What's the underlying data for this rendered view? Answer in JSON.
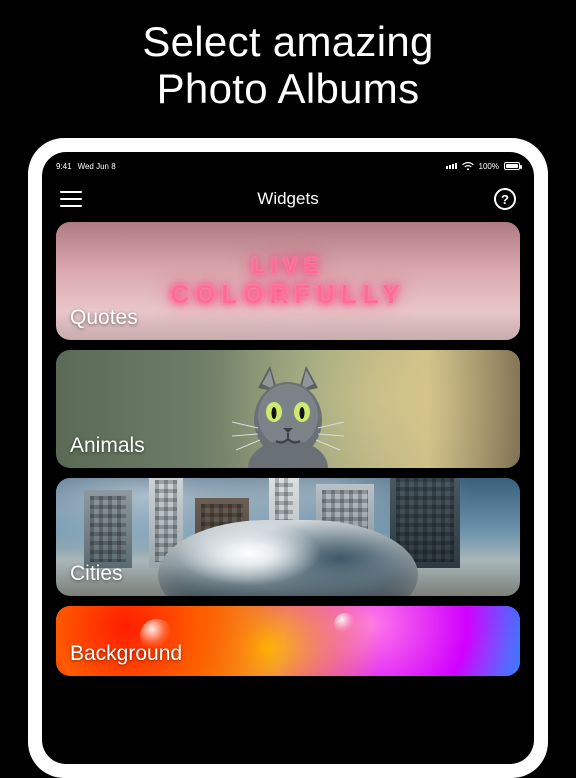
{
  "promo": {
    "line1": "Select amazing",
    "line2": "Photo Albums"
  },
  "statusbar": {
    "time": "9:41",
    "date": "Wed Jun 8",
    "battery_pct": "100%"
  },
  "navbar": {
    "title": "Widgets",
    "help_glyph": "?"
  },
  "cards": [
    {
      "label": "Quotes",
      "neon_line1": "LIVE",
      "neon_line2": "COLORFULLY"
    },
    {
      "label": "Animals"
    },
    {
      "label": "Cities"
    },
    {
      "label": "Background"
    }
  ]
}
